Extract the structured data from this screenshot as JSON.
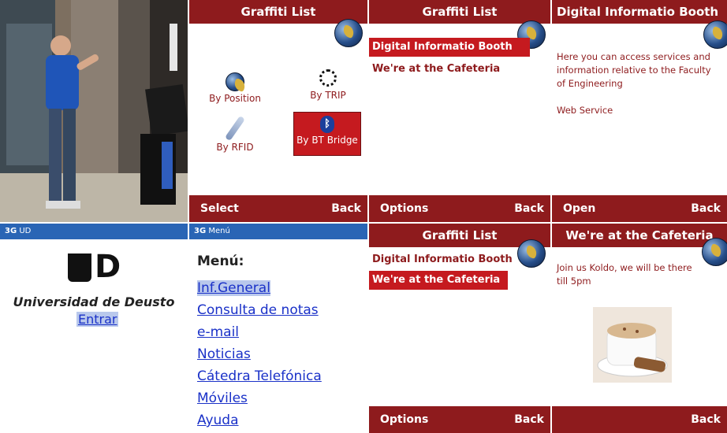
{
  "photo": {
    "alt": "student using phone in front of info booth"
  },
  "graffiti_buttons": {
    "header": "Graffiti List",
    "buttons": [
      {
        "label": "By Position",
        "icon": "globe-icon"
      },
      {
        "label": "By TRIP",
        "icon": "trip-target-icon"
      },
      {
        "label": "By RFID",
        "icon": "rfid-wand-icon"
      },
      {
        "label": "By BT Bridge",
        "icon": "bluetooth-icon"
      }
    ],
    "footer_left": "Select",
    "footer_right": "Back"
  },
  "graffiti_list_1": {
    "header": "Graffiti List",
    "items": [
      "Digital Informatio Booth",
      "We're at the Cafeteria"
    ],
    "selected_index": 0,
    "footer_left": "Options",
    "footer_right": "Back"
  },
  "booth_detail": {
    "header": "Digital Informatio Booth",
    "text": "Here you can access services and information relative to the Faculty of Engineering",
    "link": "Web Service",
    "footer_left": "Open",
    "footer_right": "Back"
  },
  "deusto_login": {
    "status": "UD",
    "status_network": "3G",
    "university": "Universidad de Deusto",
    "enter": "Entrar"
  },
  "menu": {
    "status": "Menú",
    "status_network": "3G",
    "title": "Menú:",
    "items": [
      "Inf.General",
      "Consulta de notas",
      "e-mail",
      "Noticias",
      "Cátedra Telefónica",
      "Móviles",
      "Ayuda"
    ]
  },
  "graffiti_list_2": {
    "header": "Graffiti List",
    "items": [
      "Digital Informatio Booth",
      "We're at the Cafeteria"
    ],
    "selected_index": 1,
    "footer_left": "Options",
    "footer_right": "Back"
  },
  "cafeteria_detail": {
    "header": "We're at the Cafeteria",
    "text": "Join us Koldo, we will be there till 5pm",
    "footer_right": "Back"
  },
  "colors": {
    "maroon": "#8e1b1d",
    "selected": "#c51a1f",
    "statusbar": "#2a65b5",
    "link": "#1a31c8"
  }
}
